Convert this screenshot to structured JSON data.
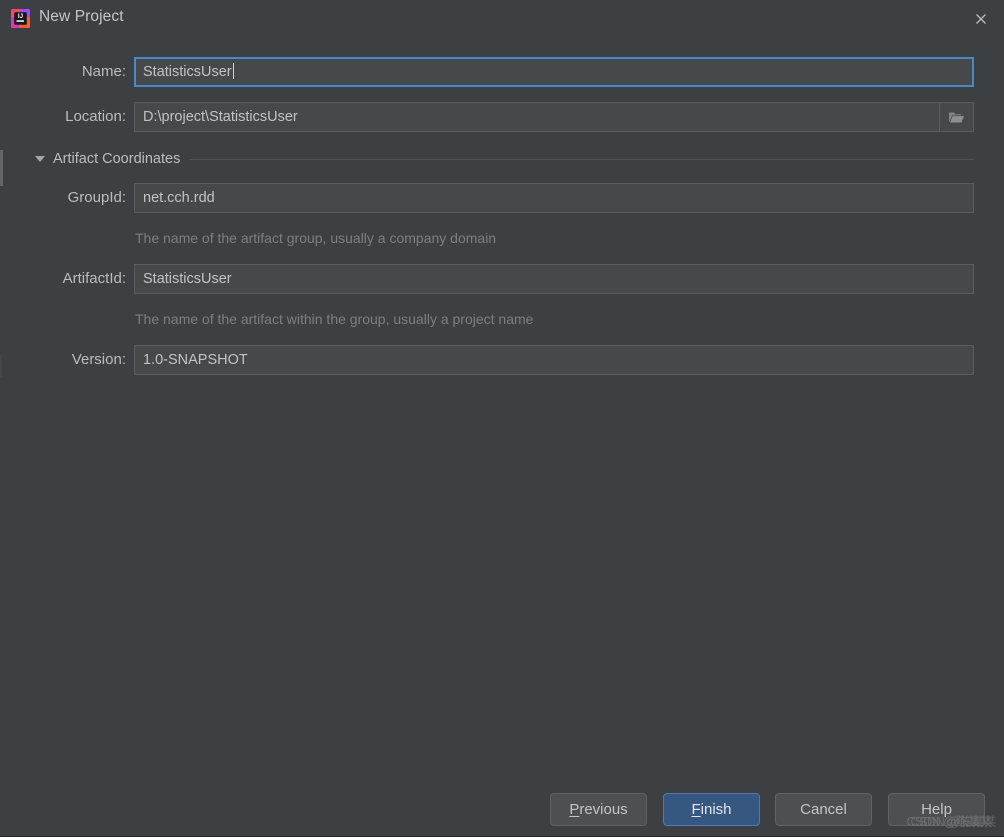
{
  "window": {
    "title": "New Project",
    "icon": "intellij-idea-icon",
    "close_icon": "close-icon",
    "background": "#3c4043"
  },
  "form": {
    "name": {
      "label": "Name:",
      "value": "StatisticsUser",
      "focused": true,
      "focus_color": "#4a88c7"
    },
    "location": {
      "label": "Location:",
      "value": "D:\\project\\StatisticsUser",
      "browse_icon": "folder-icon"
    },
    "section": {
      "title": "Artifact Coordinates",
      "expanded": true,
      "toggle_icon": "chevron-down-icon"
    },
    "group_id": {
      "label": "GroupId:",
      "value": "net.cch.rdd",
      "hint": "The name of the artifact group, usually a company domain"
    },
    "artifact_id": {
      "label": "ArtifactId:",
      "value": "StatisticsUser",
      "hint": "The name of the artifact within the group, usually a project name"
    },
    "version": {
      "label": "Version:",
      "value": "1.0-SNAPSHOT"
    }
  },
  "buttons": {
    "previous": {
      "label_pre": "",
      "mnemonic": "P",
      "label_post": "revious"
    },
    "finish": {
      "label_pre": "",
      "mnemonic": "F",
      "label_post": "inish",
      "primary": true,
      "color": "#365880"
    },
    "cancel": {
      "label": "Cancel"
    },
    "help": {
      "label": "Help"
    }
  },
  "watermark": {
    "text": "CSDN @陈某某",
    "text2": "CSDN @陈某某"
  }
}
